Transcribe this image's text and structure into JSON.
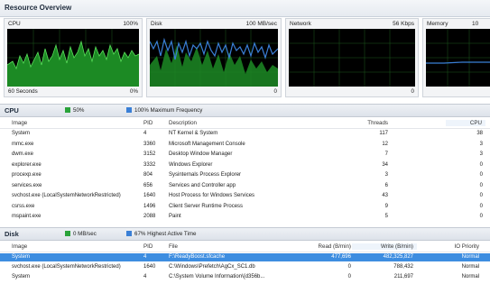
{
  "window": {
    "title": "Resource Overview"
  },
  "graphs": [
    {
      "name": "CPU",
      "top_right": "100%",
      "bottom_left": "60 Seconds",
      "bottom_right": "0%"
    },
    {
      "name": "Disk",
      "top_right": "100 MB/sec",
      "bottom_right": "0"
    },
    {
      "name": "Network",
      "top_right": "56 Kbps",
      "bottom_right": "0"
    },
    {
      "name": "Memory",
      "top_right": "10"
    }
  ],
  "cpu": {
    "title": "CPU",
    "usage_label": "50%",
    "max_freq_label": "100% Maximum Frequency",
    "colors": {
      "usage": "#2aa33a",
      "max_freq": "#3a7fd6"
    },
    "columns": {
      "image": "Image",
      "pid": "PID",
      "description": "Description",
      "threads": "Threads",
      "cpu": "CPU"
    },
    "rows": [
      {
        "image": "System",
        "pid": "4",
        "description": "NT Kernel & System",
        "threads": "117",
        "cpu": "38"
      },
      {
        "image": "mmc.exe",
        "pid": "3360",
        "description": "Microsoft Management Console",
        "threads": "12",
        "cpu": "3"
      },
      {
        "image": "dwm.exe",
        "pid": "3152",
        "description": "Desktop Window Manager",
        "threads": "7",
        "cpu": "3"
      },
      {
        "image": "explorer.exe",
        "pid": "3332",
        "description": "Windows Explorer",
        "threads": "34",
        "cpu": "0"
      },
      {
        "image": "procexp.exe",
        "pid": "804",
        "description": "Sysinternals Process Explorer",
        "threads": "3",
        "cpu": "0"
      },
      {
        "image": "services.exe",
        "pid": "656",
        "description": "Services and Controller app",
        "threads": "6",
        "cpu": "0"
      },
      {
        "image": "svchost.exe (LocalSystemNetworkRestricted)",
        "pid": "1640",
        "description": "Host Process for Windows Services",
        "threads": "43",
        "cpu": "0"
      },
      {
        "image": "csrss.exe",
        "pid": "1496",
        "description": "Client Server Runtime Process",
        "threads": "9",
        "cpu": "0"
      },
      {
        "image": "mspaint.exe",
        "pid": "2088",
        "description": "Paint",
        "threads": "5",
        "cpu": "0"
      }
    ]
  },
  "disk": {
    "title": "Disk",
    "rate_label": "0 MB/sec",
    "active_label": "67% Highest Active Time",
    "colors": {
      "rate": "#2aa33a",
      "active": "#3a7fd6"
    },
    "columns": {
      "image": "Image",
      "pid": "PID",
      "file": "File",
      "read": "Read (B/min)",
      "write": "Write (B/min)",
      "priority": "IO Priority"
    },
    "rows": [
      {
        "image": "System",
        "pid": "4",
        "file": "F:\\ReadyBoost.sfcache",
        "read": "477,696",
        "write": "482,325,827",
        "priority": "Normal",
        "selected": true
      },
      {
        "image": "svchost.exe (LocalSystemNetworkRestricted)",
        "pid": "1640",
        "file": "C:\\Windows\\Prefetch\\AgCx_SC1.db",
        "read": "0",
        "write": "788,432",
        "priority": "Normal"
      },
      {
        "image": "System",
        "pid": "4",
        "file": "C:\\System Volume Information\\{d356b...",
        "read": "0",
        "write": "211,697",
        "priority": "Normal"
      }
    ]
  }
}
